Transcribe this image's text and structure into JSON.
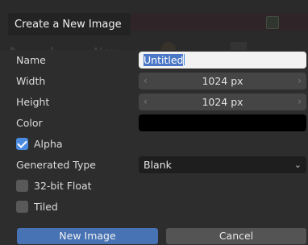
{
  "dialog": {
    "title": "Create a New Image"
  },
  "background": {
    "new_label": "New",
    "plus_label": "+",
    "edit_label": "✎"
  },
  "fields": {
    "name": {
      "label": "Name",
      "value": "Untitled"
    },
    "width": {
      "label": "Width",
      "value": "1024 px"
    },
    "height": {
      "label": "Height",
      "value": "1024 px"
    },
    "color": {
      "label": "Color",
      "value_hex": "#000000"
    },
    "alpha": {
      "label": "Alpha",
      "checked": true
    },
    "generated_type": {
      "label": "Generated Type",
      "value": "Blank"
    },
    "float": {
      "label": "32-bit Float",
      "checked": false
    },
    "tiled": {
      "label": "Tiled",
      "checked": false
    }
  },
  "buttons": {
    "ok": "New Image",
    "cancel": "Cancel"
  },
  "colors": {
    "accent": "#4772b3",
    "checkbox_on": "#4a8ae0"
  }
}
